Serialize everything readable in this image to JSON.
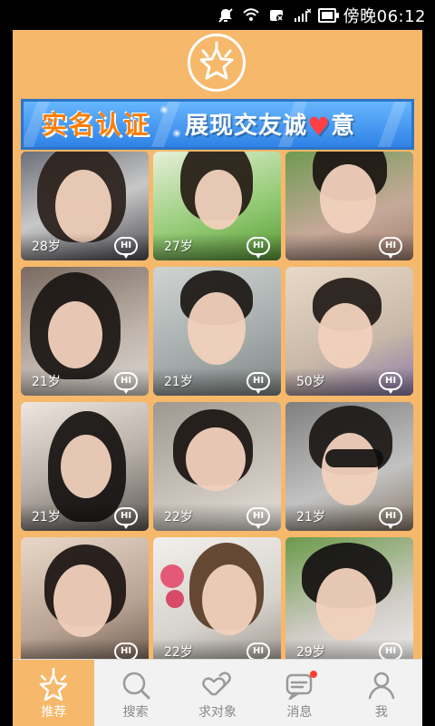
{
  "status_bar": {
    "icons": [
      "mute-icon",
      "wifi-icon",
      "sim-icon",
      "signal-icon",
      "battery-icon"
    ],
    "time": "傍晚06:12"
  },
  "header": {
    "logo_icon": "star-badge-icon"
  },
  "banner": {
    "left_text": "实名认证",
    "right_text_before_heart": "展现交友诚",
    "heart": "♥",
    "right_text_after_heart": "意"
  },
  "profiles": [
    {
      "age": "28岁",
      "hi": "HI"
    },
    {
      "age": "27岁",
      "hi": "HI"
    },
    {
      "age": "",
      "hi": "HI"
    },
    {
      "age": "21岁",
      "hi": "HI"
    },
    {
      "age": "21岁",
      "hi": "HI"
    },
    {
      "age": "50岁",
      "hi": "HI"
    },
    {
      "age": "21岁",
      "hi": "HI"
    },
    {
      "age": "22岁",
      "hi": "HI"
    },
    {
      "age": "21岁",
      "hi": "HI"
    },
    {
      "age": "",
      "hi": "HI"
    },
    {
      "age": "22岁",
      "hi": "HI"
    },
    {
      "age": "29岁",
      "hi": "HI"
    }
  ],
  "tabs": [
    {
      "label": "推荐",
      "icon": "star-icon",
      "active": true
    },
    {
      "label": "搜索",
      "icon": "search-icon",
      "active": false
    },
    {
      "label": "求对象",
      "icon": "hearts-icon",
      "active": false
    },
    {
      "label": "消息",
      "icon": "message-icon",
      "active": false,
      "has_badge": true
    },
    {
      "label": "我",
      "icon": "user-icon",
      "active": false
    }
  ],
  "colors": {
    "accent": "#f6b86a",
    "banner_blue": "#2f82e6",
    "banner_orange": "#ff7d00",
    "badge_red": "#ff3c2f"
  }
}
